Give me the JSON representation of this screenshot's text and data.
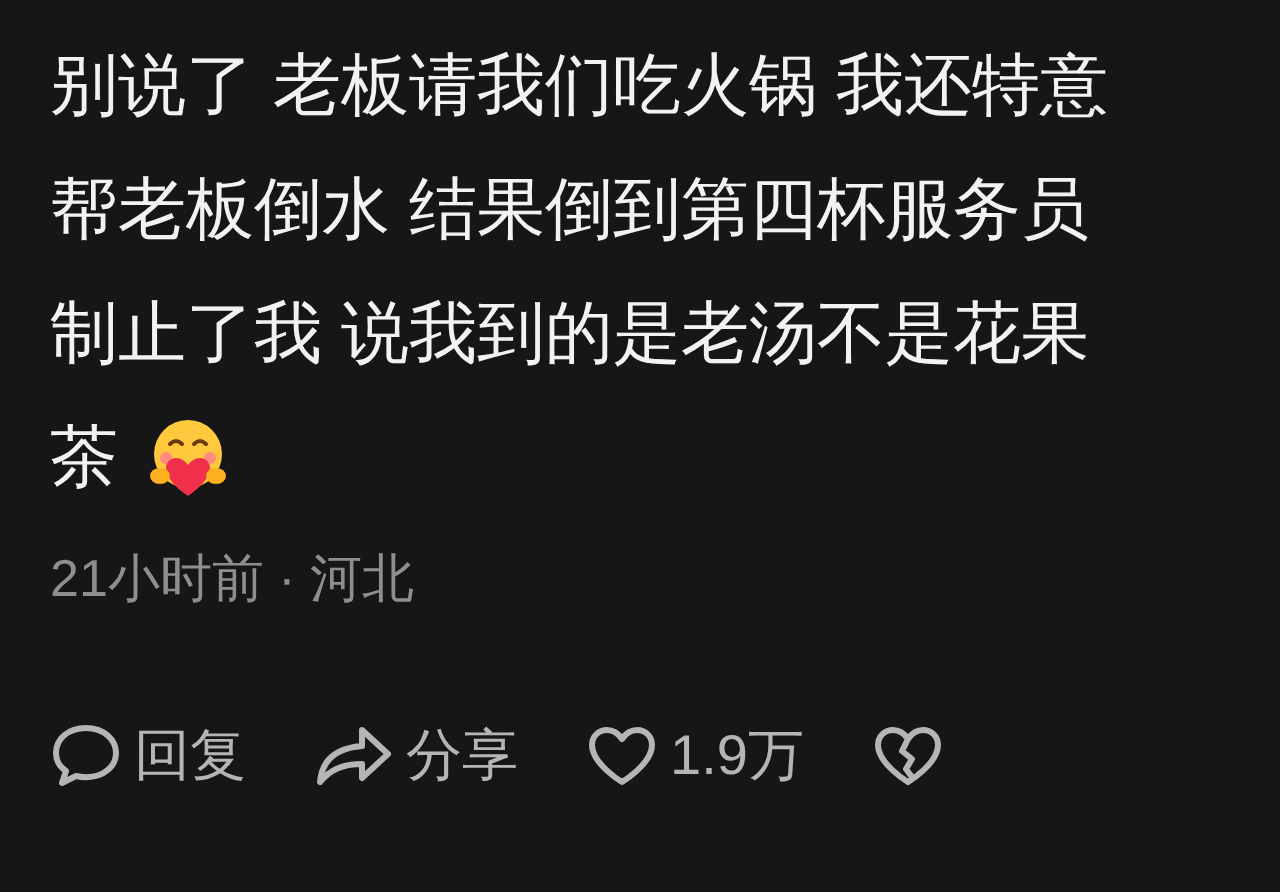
{
  "comment": {
    "lines": [
      "别说了 老板请我们吃火锅 我还特意",
      "帮老板倒水 结果倒到第四杯服务员",
      "制止了我 说我到的是老汤不是花果",
      "茶"
    ],
    "meta": "21小时前 · 河北"
  },
  "actions": [
    {
      "kind": "reply",
      "label": "回复"
    },
    {
      "kind": "share",
      "label": "分享"
    },
    {
      "kind": "like",
      "label": "1.9万"
    },
    {
      "kind": "dislike"
    }
  ]
}
